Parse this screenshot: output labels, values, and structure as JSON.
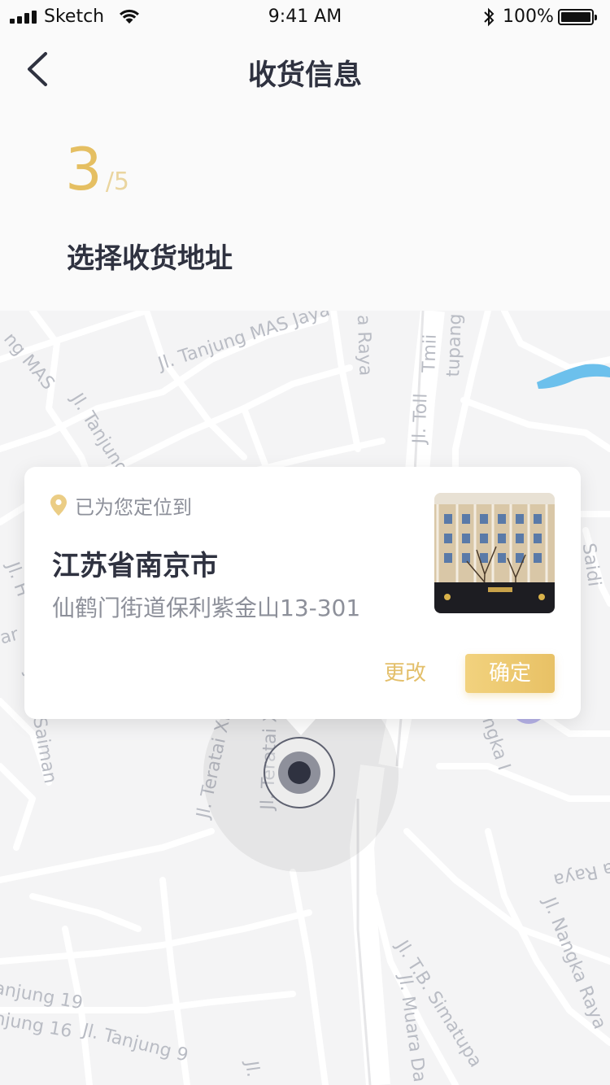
{
  "status_bar": {
    "carrier": "Sketch",
    "time": "9:41 AM",
    "battery": "100%"
  },
  "header": {
    "title": "收货信息"
  },
  "step": {
    "current": "3",
    "total": "/5",
    "title": "选择收货地址"
  },
  "map": {
    "street_labels": [
      "Jl. Tanjung MAS Jaya",
      "ng MAS",
      "Jl. Tanjung M",
      "a Raya",
      "tupang",
      "Jl. Toll",
      "Tmii",
      "Jl. H",
      "ar",
      "Jl. H. Saiman",
      "Jl. Teratai XII",
      "Jl. Teratai X",
      "ngka I",
      "Saidi",
      "a Raya",
      "Jl. Nangka Raya",
      "anjung 19",
      "njung 16",
      "Jl. Tanjung 9",
      "Jl. T.B. Simatupa",
      "Jl. Muara Da",
      "Jl."
    ]
  },
  "location_card": {
    "located_label": "已为您定位到",
    "city": "江苏省南京市",
    "address": "仙鹤门街道保利紫金山13-301",
    "change_button": "更改",
    "confirm_button": "确定"
  },
  "colors": {
    "accent": "#e5bf62",
    "title": "#2f3240",
    "secondary_text": "#8d909a"
  }
}
